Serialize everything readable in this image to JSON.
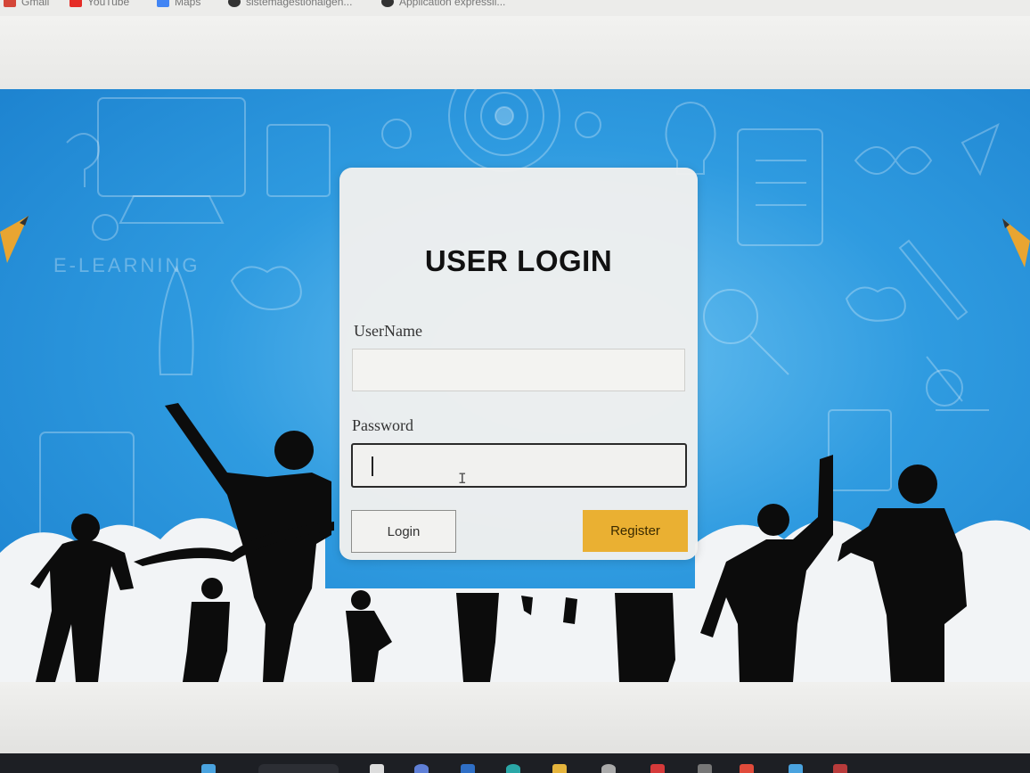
{
  "browser": {
    "bookmarks": [
      {
        "label": "Gmail",
        "icon": "gmail-icon",
        "color": "#d44638"
      },
      {
        "label": "YouTube",
        "icon": "youtube-icon",
        "color": "#e52d27"
      },
      {
        "label": "Maps",
        "icon": "maps-icon",
        "color": "#4285f4"
      },
      {
        "label": "sistemagestionalgen...",
        "icon": "globe-icon",
        "color": "#333333"
      },
      {
        "label": "Application expressli...",
        "icon": "globe-icon",
        "color": "#333333"
      }
    ]
  },
  "login": {
    "title": "USER LOGIN",
    "username_label": "UserName",
    "username_value": "",
    "password_label": "Password",
    "password_value": "",
    "login_button": "Login",
    "register_button": "Register"
  },
  "hero": {
    "doodle_text": "E-LEARNING"
  },
  "colors": {
    "register_accent": "#eab032",
    "hero_blue": "#2f9be0"
  }
}
